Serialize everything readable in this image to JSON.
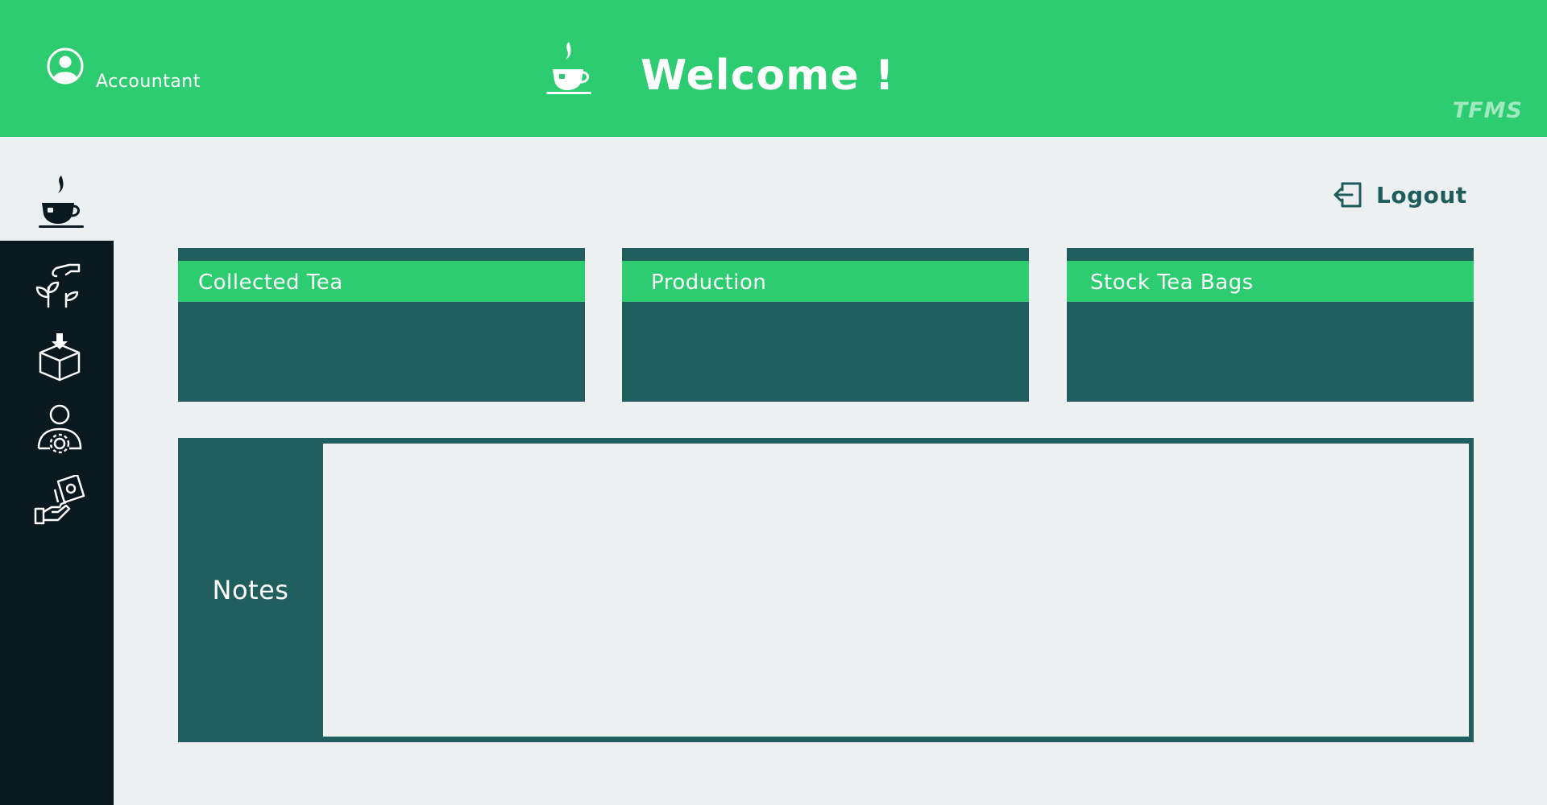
{
  "header": {
    "role": "Accountant",
    "title": "Welcome !",
    "brand": "TFMS",
    "icons": [
      "user-icon",
      "tea-cup-icon"
    ]
  },
  "sidebar": {
    "items": [
      {
        "icon": "tea-cup-icon",
        "active": true
      },
      {
        "icon": "plant-harvest-icon"
      },
      {
        "icon": "package-download-icon"
      },
      {
        "icon": "user-settings-icon"
      },
      {
        "icon": "payment-hand-icon"
      }
    ]
  },
  "logout": {
    "label": "Logout",
    "icon": "logout-icon"
  },
  "cards": [
    {
      "title": "Collected Tea"
    },
    {
      "title": "Production"
    },
    {
      "title": "Stock Tea Bags"
    }
  ],
  "notes": {
    "label": "Notes",
    "value": ""
  },
  "colors": {
    "accent": "#2ecc71",
    "dark_teal": "#215e5e",
    "sidebar": "#0a1820",
    "background": "#ecf0f1"
  }
}
